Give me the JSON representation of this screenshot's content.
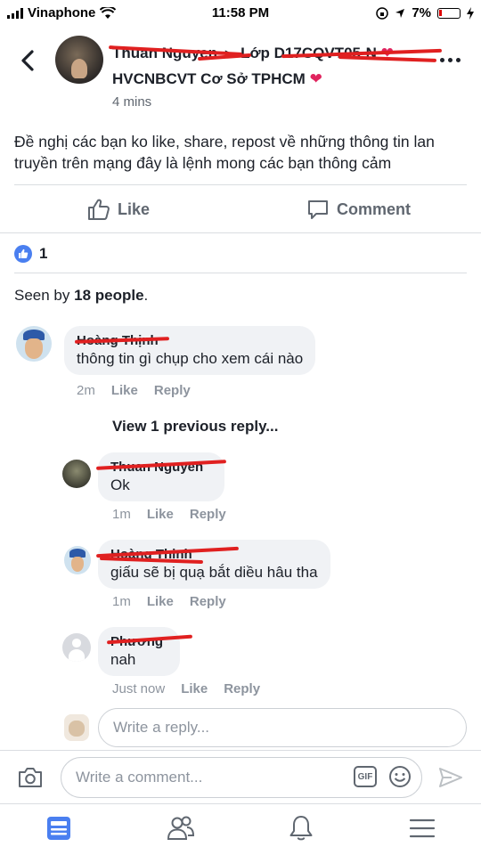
{
  "status_bar": {
    "carrier": "Vinaphone",
    "time": "11:58 PM",
    "battery": "7%"
  },
  "post": {
    "author_name": "Thuan Nguyen",
    "group_prefix": "Lớp D17CQVT05-N",
    "group_line2": "HVCNBCVT Cơ Sở TPHCM",
    "heart": "❤",
    "time": "4 mins",
    "text": "Đề nghị các bạn ko like, share, repost về những thông tin lan truyền trên mạng đây là lệnh mong các bạn thông cảm"
  },
  "actions": {
    "like_label": "Like",
    "comment_label": "Comment"
  },
  "reactions": {
    "count": "1"
  },
  "seen": {
    "prefix": "Seen by ",
    "count": "18 people",
    "suffix": "."
  },
  "comments": [
    {
      "name": "Hoàng Thịnh",
      "text": "thông tin gì chụp cho xem cái nào",
      "time": "2m",
      "like": "Like",
      "reply": "Reply"
    }
  ],
  "view_previous": "View 1 previous reply...",
  "replies": [
    {
      "name": "Thuan Nguyen",
      "text": "Ok",
      "time": "1m",
      "like": "Like",
      "reply": "Reply"
    },
    {
      "name": "Hoàng Thịnh",
      "text": "giấu sẽ bị quạ bắt diều hâu tha",
      "time": "1m",
      "like": "Like",
      "reply": "Reply"
    },
    {
      "name": "Phương",
      "text": "nah",
      "time": "Just now",
      "like": "Like",
      "reply": "Reply"
    }
  ],
  "reply_placeholder": "Write a reply...",
  "comment_placeholder": "Write a comment...",
  "gif_label": "GIF",
  "colors": {
    "accent": "#4a7ff0",
    "redaction": "#e02020",
    "heart": "#e0245e",
    "muted": "#8d949e"
  },
  "icons": [
    "back-chevron-icon",
    "more-dots-icon",
    "thumbs-up-icon",
    "comment-icon",
    "camera-icon",
    "gif-icon",
    "emoji-icon",
    "send-icon",
    "news-feed-icon",
    "friends-icon",
    "bell-icon",
    "menu-icon"
  ]
}
